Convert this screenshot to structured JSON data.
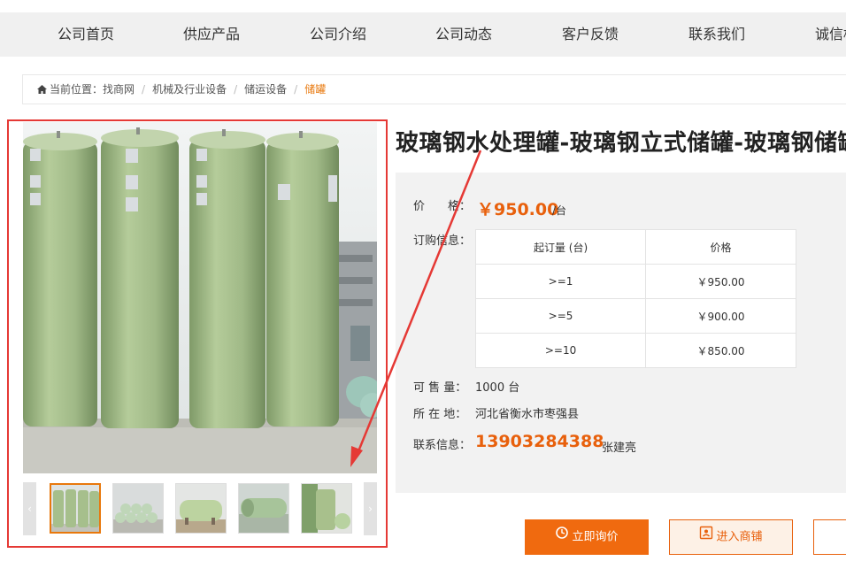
{
  "nav": {
    "items": [
      "公司首页",
      "供应产品",
      "公司介绍",
      "公司动态",
      "客户反馈",
      "联系我们",
      "诚信档案"
    ]
  },
  "breadcrumb": {
    "prefix": "当前位置：",
    "items": [
      "找商网",
      "机械及行业设备",
      "储运设备"
    ],
    "current": "储罐"
  },
  "product": {
    "title": "玻璃钢水处理罐-玻璃钢立式储罐-玻璃钢储罐",
    "price_label": "价　　格：",
    "price": "￥950.00",
    "unit": "/台",
    "order_label": "订购信息：",
    "tier_headers": [
      "起订量 (台)",
      "价格"
    ],
    "tiers": [
      [
        ">=1",
        "￥950.00"
      ],
      [
        ">=5",
        "￥900.00"
      ],
      [
        ">=10",
        "￥850.00"
      ]
    ],
    "stock_label": "可 售 量：",
    "stock": "1000 台",
    "location_label": "所 在 地：",
    "location": "河北省衡水市枣强县",
    "contact_label": "联系信息：",
    "phone": "13903284388",
    "contact_name": "张建亮"
  },
  "gallery": {
    "thumbs": [
      "tanks-row",
      "pipes-stack",
      "horizontal-tanks",
      "green-pipes",
      "tank-and-trees"
    ]
  },
  "actions": {
    "inquire": "立即询价",
    "shop": "进入商铺"
  },
  "colors": {
    "accent": "#e8600c",
    "annotation": "#e53935",
    "tank": "#a8c08c"
  }
}
